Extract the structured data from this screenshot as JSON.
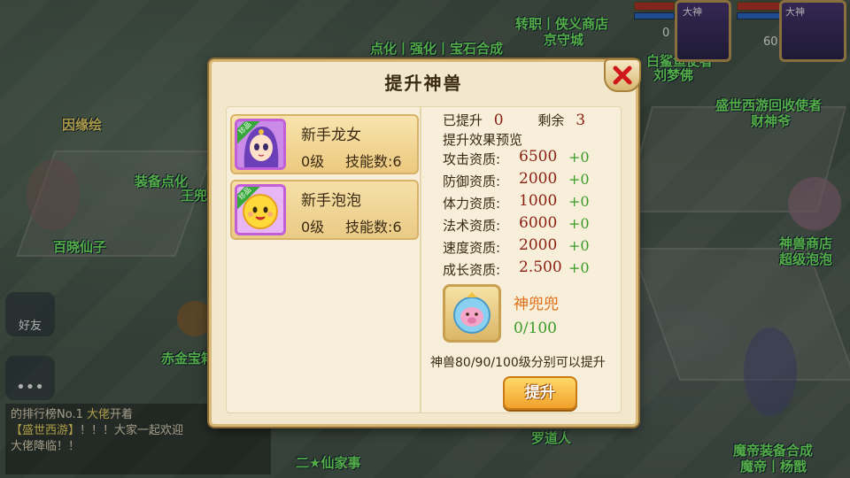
{
  "scene": {
    "npc_labels": {
      "yinyuan": "因缘绘",
      "zhuanzhi": "转职丨侠义商店",
      "jingshou": "京守城",
      "dianhua": "点化丨强化丨宝石合成",
      "liumeng": "刘梦佛",
      "baishi": "白鲨鱼使者",
      "caishen": "盛世西游回收使者",
      "caishen2": "财神爷",
      "zhuangbei": "装备点化",
      "wangzhe": "王兜",
      "bailong": "百晓仙子",
      "shenshou": "神兽商店",
      "chaoji": "超级泡泡",
      "chijin": "赤金宝箱",
      "luodao": "罗道人",
      "mohuang": "魔帝装备合成",
      "modi": "魔帝丨杨戬",
      "haoyou": "好友",
      "task": "二★仙家事"
    },
    "portraits": {
      "left_badge": "大神",
      "right_badge": "大神",
      "left_level": "0",
      "right_level": "60"
    },
    "chat": {
      "line1_prefix": "的排行榜No.1",
      "line1_name": "大佬",
      "line1_suffix": "开着",
      "line2_link": "【盛世西游】",
      "line2_rest": "！！！大家一起欢迎",
      "line3": "大佬降临！！"
    }
  },
  "dialog": {
    "title": "提升神兽",
    "close_label": "✕",
    "pets": [
      {
        "name": "新手龙女",
        "level": "0级",
        "skill_label": "技能数:6",
        "rarity": "珍品"
      },
      {
        "name": "新手泡泡",
        "level": "0级",
        "skill_label": "技能数:6",
        "rarity": "珍品"
      }
    ],
    "upgraded_label": "已提升",
    "upgraded_value": "0",
    "remaining_label": "剩余",
    "remaining_value": "3",
    "preview_label": "提升效果预览",
    "attributes": [
      {
        "label": "攻击资质:",
        "value": "6500",
        "plus": "+0"
      },
      {
        "label": "防御资质:",
        "value": "2000",
        "plus": "+0"
      },
      {
        "label": "体力资质:",
        "value": "1000",
        "plus": "+0"
      },
      {
        "label": "法术资质:",
        "value": "6000",
        "plus": "+0"
      },
      {
        "label": "速度资质:",
        "value": "2000",
        "plus": "+0"
      },
      {
        "label": "成长资质:",
        "value": "2.500",
        "plus": "+0"
      }
    ],
    "item": {
      "name": "神兜兜",
      "count": "0/100"
    },
    "hint": "神兽80/90/100级分别可以提升",
    "upgrade_button": "提升"
  },
  "colors": {
    "panel": "#f3e8ce",
    "value_red": "#8a1e12",
    "plus_green": "#3a9a28",
    "item_orange": "#e0701c",
    "button_orange": "#f0a22c"
  }
}
